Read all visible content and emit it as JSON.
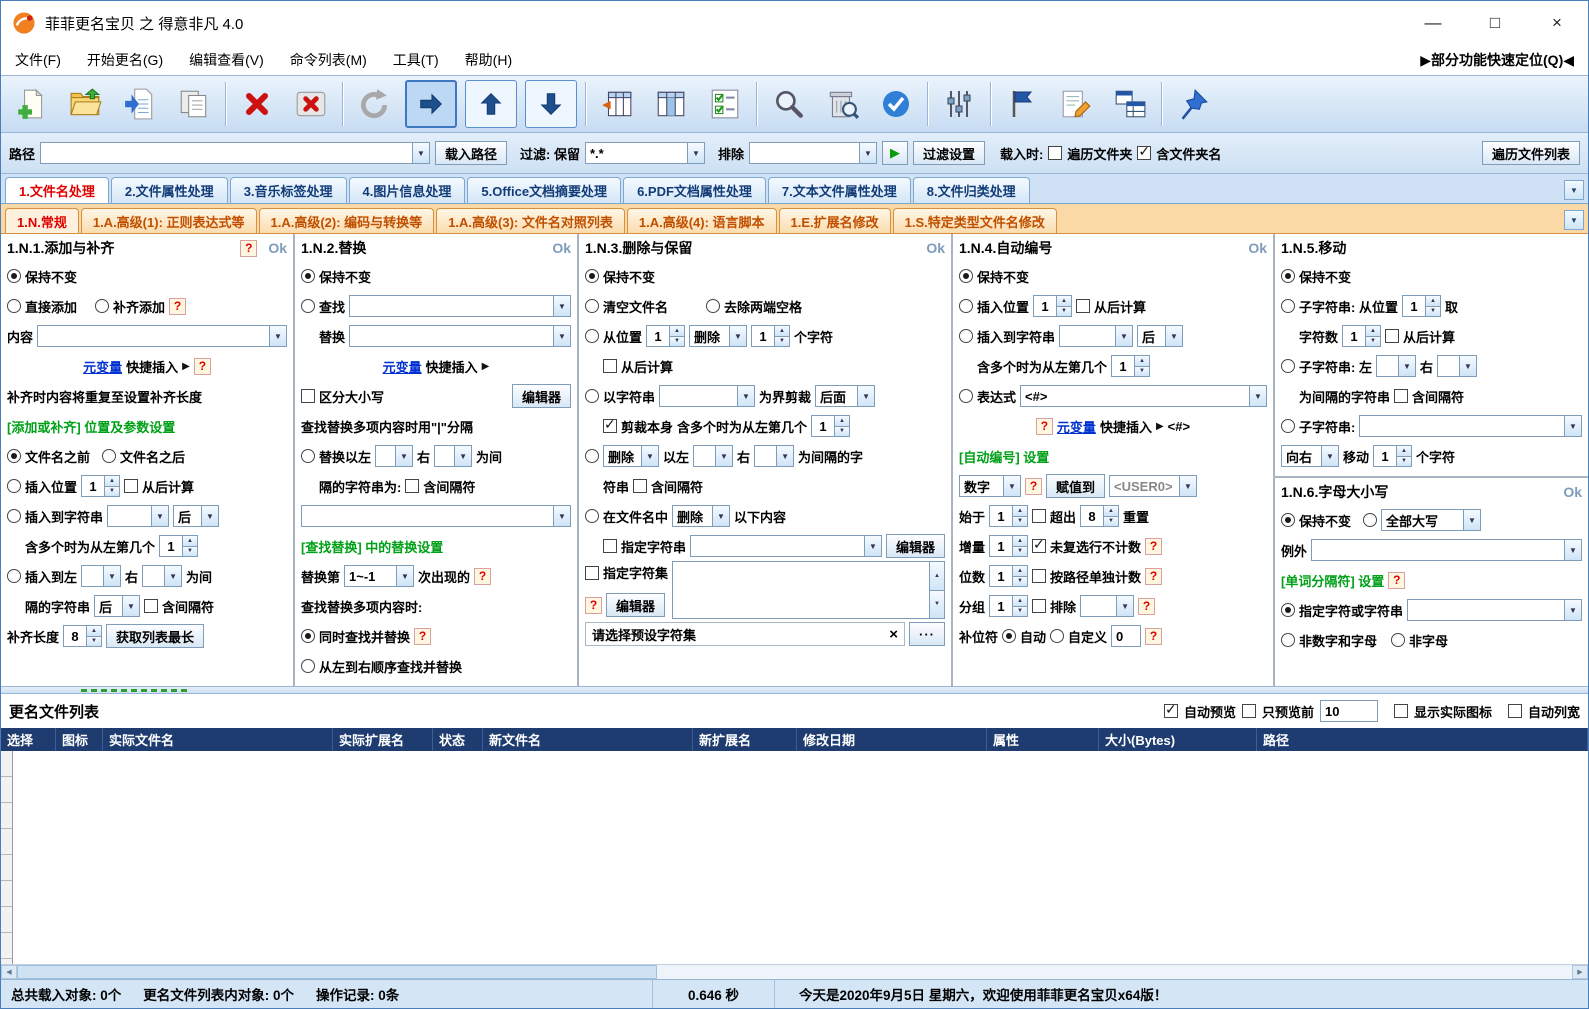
{
  "titlebar": {
    "title": "菲菲更名宝贝 之 得意非凡 4.0",
    "minimize": "—",
    "maximize": "□",
    "close": "×"
  },
  "menubar": {
    "items": [
      "文件(F)",
      "开始更名(G)",
      "编辑查看(V)",
      "命令列表(M)",
      "工具(T)",
      "帮助(H)"
    ],
    "quick_locate": "▶部分功能快速定位(Q)◀"
  },
  "toolbar": {
    "icons": [
      "new-file",
      "open-folder",
      "load-file-list",
      "save-list",
      "delete-x",
      "clear-x",
      "refresh",
      "move-right",
      "move-up",
      "move-down",
      "insert-columns",
      "columns",
      "check-list",
      "search",
      "trash-search",
      "check-circle",
      "settings-sliders",
      "flag",
      "edit-pencil",
      "batch-tables",
      "pushpin"
    ]
  },
  "pathbar": {
    "path_label": "路径",
    "path_value": "",
    "load_path_button": "载入路径",
    "filter_label": "过滤: 保留",
    "filter_value": "*.*",
    "exclude_label": "排除",
    "exclude_value": "",
    "run_icon": "▶",
    "filter_settings_button": "过滤设置",
    "load_when_label": "载入时:",
    "traverse_folders": "遍历文件夹",
    "include_folder_name": "含文件夹名",
    "traverse_list_button": "遍历文件列表"
  },
  "main_tabs": {
    "items": [
      "1.文件名处理",
      "2.文件属性处理",
      "3.音乐标签处理",
      "4.图片信息处理",
      "5.Office文档摘要处理",
      "6.PDF文档属性处理",
      "7.文本文件属性处理",
      "8.文件归类处理"
    ]
  },
  "sub_tabs": {
    "items": [
      "1.N.常规",
      "1.A.高级(1): 正则表达式等",
      "1.A.高级(2): 编码与转换等",
      "1.A.高级(3): 文件名对照列表",
      "1.A.高级(4): 语言脚本",
      "1.E.扩展名修改",
      "1.S.特定类型文件名修改"
    ]
  },
  "panel_add": {
    "title": "1.N.1.添加与补齐",
    "help": "?",
    "ok": "Ok",
    "keep": "保持不变",
    "direct_add": "直接添加",
    "pad_add": "补齐添加",
    "content_label": "内容",
    "var_link": "元变量",
    "var_rest": "快捷插入",
    "pad_note": "补齐时内容将重复至设置补齐长度",
    "section": "[添加或补齐] 位置及参数设置",
    "before_name": "文件名之前",
    "after_name": "文件名之后",
    "insert_pos": "插入位置",
    "insert_pos_value": "1",
    "from_end": "从后计算",
    "insert_to_string": "插入到字符串",
    "after_value": "后",
    "multi_label": "含多个时为从左第几个",
    "multi_value": "1",
    "between_left": "插入到左",
    "right_label": "右",
    "between_suffix": "为间",
    "sep_line": "隔的字符串",
    "include_sep": "含间隔符",
    "pad_len_label": "补齐长度",
    "pad_len_value": "8",
    "get_longest_button": "获取列表最长"
  },
  "panel_replace": {
    "title": "1.N.2.替换",
    "help": "?",
    "ok": "Ok",
    "keep": "保持不变",
    "find_label": "查找",
    "replace_label": "替换",
    "var_link": "元变量",
    "var_rest": "快捷插入",
    "case_sensitive": "区分大小写",
    "editor_button": "编辑器",
    "multi_note": "查找替换多项内容时用\"|\"分隔",
    "between_left": "替换以左",
    "right_label": "右",
    "between_suffix": "为间",
    "sep_line": "隔的字符串为:",
    "include_sep": "含间隔符",
    "section": "[查找替换] 中的替换设置",
    "replace_nth_label": "替换第",
    "replace_nth_value": "1~-1",
    "occurrence_suffix": "次出现的",
    "multi_mode_label": "查找替换多项内容时:",
    "simultaneous": "同时查找并替换",
    "sequential": "从左到右顺序查找并替换"
  },
  "panel_delete": {
    "title": "1.N.3.删除与保留",
    "help": "?",
    "ok": "Ok",
    "keep": "保持不变",
    "clear_name": "清空文件名",
    "trim_spaces": "去除两端空格",
    "from_pos": "从位置",
    "pos_value": "1",
    "delete_value": "删除",
    "count_value": "1",
    "char_suffix": "个字符",
    "from_end": "从后计算",
    "by_string": "以字符串",
    "crop_label": "为界剪裁",
    "crop_side_value": "后面",
    "crop_self": "剪裁本身",
    "multi_label": "含多个时为从左第几个",
    "multi_value": "1",
    "left_label": "以左",
    "right_label": "右",
    "between_suffix": "为间隔的字",
    "string_cont": "符串",
    "include_sep": "含间隔符",
    "in_name_label": "在文件名中",
    "in_name_suffix": "以下内容",
    "spec_string": "指定字符串",
    "editor_button": "编辑器",
    "spec_charset": "指定字符集",
    "preset_placeholder": "请选择预设字符集",
    "clear_icon": "×",
    "more_button": "···"
  },
  "panel_number": {
    "title": "1.N.4.自动编号",
    "help": "?",
    "ok": "Ok",
    "keep": "保持不变",
    "insert_pos": "插入位置",
    "pos_value": "1",
    "from_end": "从后计算",
    "insert_to_string": "插入到字符串",
    "after_value": "后",
    "multi_label": "含多个时为从左第几个",
    "multi_value": "1",
    "expression_label": "表达式",
    "expression_value": "<#>",
    "var_link": "元变量",
    "var_rest": "快捷插入",
    "var_tag": "<#>",
    "section": "[自动编号] 设置",
    "type_value": "数字",
    "assign_button": "赋值到",
    "assign_target": "<USER0>",
    "start_label": "始于",
    "start_value": "1",
    "over_label": "超出",
    "over_value": "8",
    "reset_suffix": "重置",
    "inc_label": "增量",
    "inc_value": "1",
    "skip_unchecked": "未复选行不计数",
    "digits_label": "位数",
    "digits_value": "1",
    "per_path": "按路径单独计数",
    "group_label": "分组",
    "group_value": "1",
    "exclude_label": "排除",
    "pad_label": "补位符",
    "auto_label": "自动",
    "custom_label": "自定义",
    "custom_value": "0"
  },
  "panel_move": {
    "title": "1.N.5.移动",
    "keep": "保持不变",
    "sub_pos_label": "子字符串: 从位置",
    "pos_value": "1",
    "take_suffix": "取",
    "count_label": "字符数",
    "count_value": "1",
    "from_end": "从后计算",
    "sub_between_label": "子字符串: 左",
    "right_label": "右",
    "between_line": "为间隔的字符串",
    "include_sep": "含间隔符",
    "sub_label": "子字符串:",
    "dir_value": "向右",
    "move_label": "移动",
    "move_value": "1",
    "char_suffix": "个字符"
  },
  "panel_case": {
    "title": "1.N.6.字母大小写",
    "help": "?",
    "ok": "Ok",
    "keep": "保持不变",
    "upper_value": "全部大写",
    "except_label": "例外",
    "section": "[单词分隔符] 设置",
    "spec_label": "指定字符或字符串",
    "non_alnum": "非数字和字母",
    "non_alpha": "非字母"
  },
  "filelist": {
    "title": "更名文件列表",
    "auto_preview": "自动预览",
    "preview_first": "只预览前",
    "preview_first_value": "10",
    "show_real_icons": "显示实际图标",
    "auto_col_width": "自动列宽",
    "columns": [
      "选择",
      "图标",
      "实际文件名",
      "实际扩展名",
      "状态",
      "新文件名",
      "新扩展名",
      "修改日期",
      "属性",
      "大小(Bytes)",
      "路径"
    ]
  },
  "statusbar": {
    "loaded": "总共载入对象: 0个",
    "in_list": "更名文件列表内对象: 0个",
    "ops": "操作记录: 0条",
    "time": "0.646 秒",
    "greeting": "今天是2020年9月5日 星期六，欢迎使用菲菲更名宝贝x64版！"
  }
}
